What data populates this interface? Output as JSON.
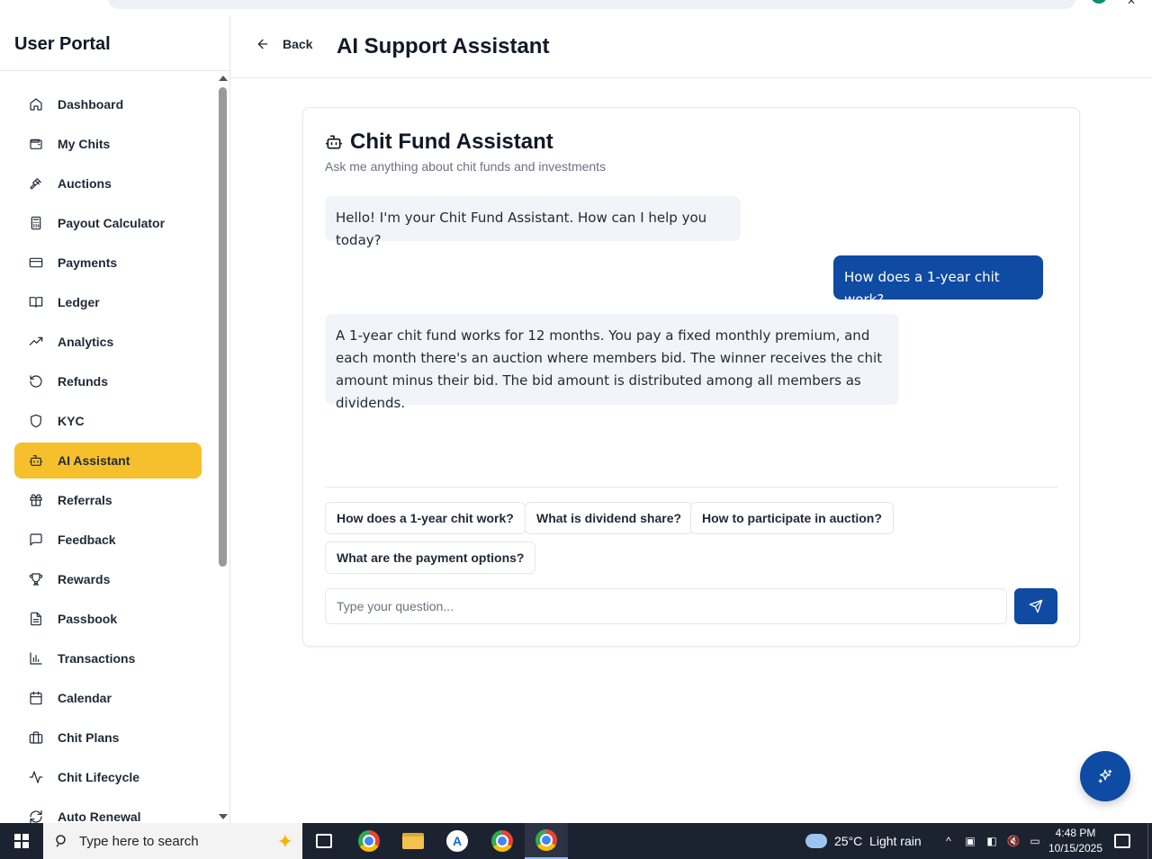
{
  "sidebar": {
    "brand": "User Portal",
    "items": [
      {
        "label": "Dashboard",
        "icon": "home-icon"
      },
      {
        "label": "My Chits",
        "icon": "wallet-icon"
      },
      {
        "label": "Auctions",
        "icon": "gavel-icon"
      },
      {
        "label": "Payout Calculator",
        "icon": "calculator-icon"
      },
      {
        "label": "Payments",
        "icon": "credit-card-icon"
      },
      {
        "label": "Ledger",
        "icon": "book-open-icon"
      },
      {
        "label": "Analytics",
        "icon": "trending-up-icon"
      },
      {
        "label": "Refunds",
        "icon": "rotate-ccw-icon"
      },
      {
        "label": "KYC",
        "icon": "shield-icon"
      },
      {
        "label": "AI Assistant",
        "icon": "bot-icon",
        "active": true
      },
      {
        "label": "Referrals",
        "icon": "gift-icon"
      },
      {
        "label": "Feedback",
        "icon": "message-square-icon"
      },
      {
        "label": "Rewards",
        "icon": "trophy-icon"
      },
      {
        "label": "Passbook",
        "icon": "file-text-icon"
      },
      {
        "label": "Transactions",
        "icon": "bar-chart-icon"
      },
      {
        "label": "Calendar",
        "icon": "calendar-icon"
      },
      {
        "label": "Chit Plans",
        "icon": "briefcase-icon"
      },
      {
        "label": "Chit Lifecycle",
        "icon": "activity-icon"
      },
      {
        "label": "Auto Renewal",
        "icon": "refresh-icon"
      }
    ]
  },
  "header": {
    "back_label": "Back",
    "title": "AI Support Assistant"
  },
  "chat": {
    "title": "Chit Fund Assistant",
    "subtitle": "Ask me anything about chit funds and investments",
    "messages": [
      {
        "role": "bot",
        "text": "Hello! I'm your Chit Fund Assistant. How can I help you today?"
      },
      {
        "role": "user",
        "text": "How does a 1-year chit work?"
      },
      {
        "role": "bot",
        "text": "A 1-year chit fund works for 12 months. You pay a fixed monthly premium, and each month there's an auction where members bid. The winner receives the chit amount minus their bid. The bid amount is distributed among all members as dividends."
      }
    ],
    "suggestions": [
      "How does a 1-year chit work?",
      "What is dividend share?",
      "How to participate in auction?",
      "What are the payment options?"
    ],
    "input_placeholder": "Type your question...",
    "input_value": ""
  },
  "taskbar": {
    "search_placeholder": "Type here to search",
    "weather": "25°C  Light rain",
    "time": "4:48 PM",
    "date": "10/15/2025"
  },
  "colors": {
    "accent": "#0f4aa3",
    "active_nav": "#f6c02c",
    "bot_bubble": "#f1f4f8"
  }
}
